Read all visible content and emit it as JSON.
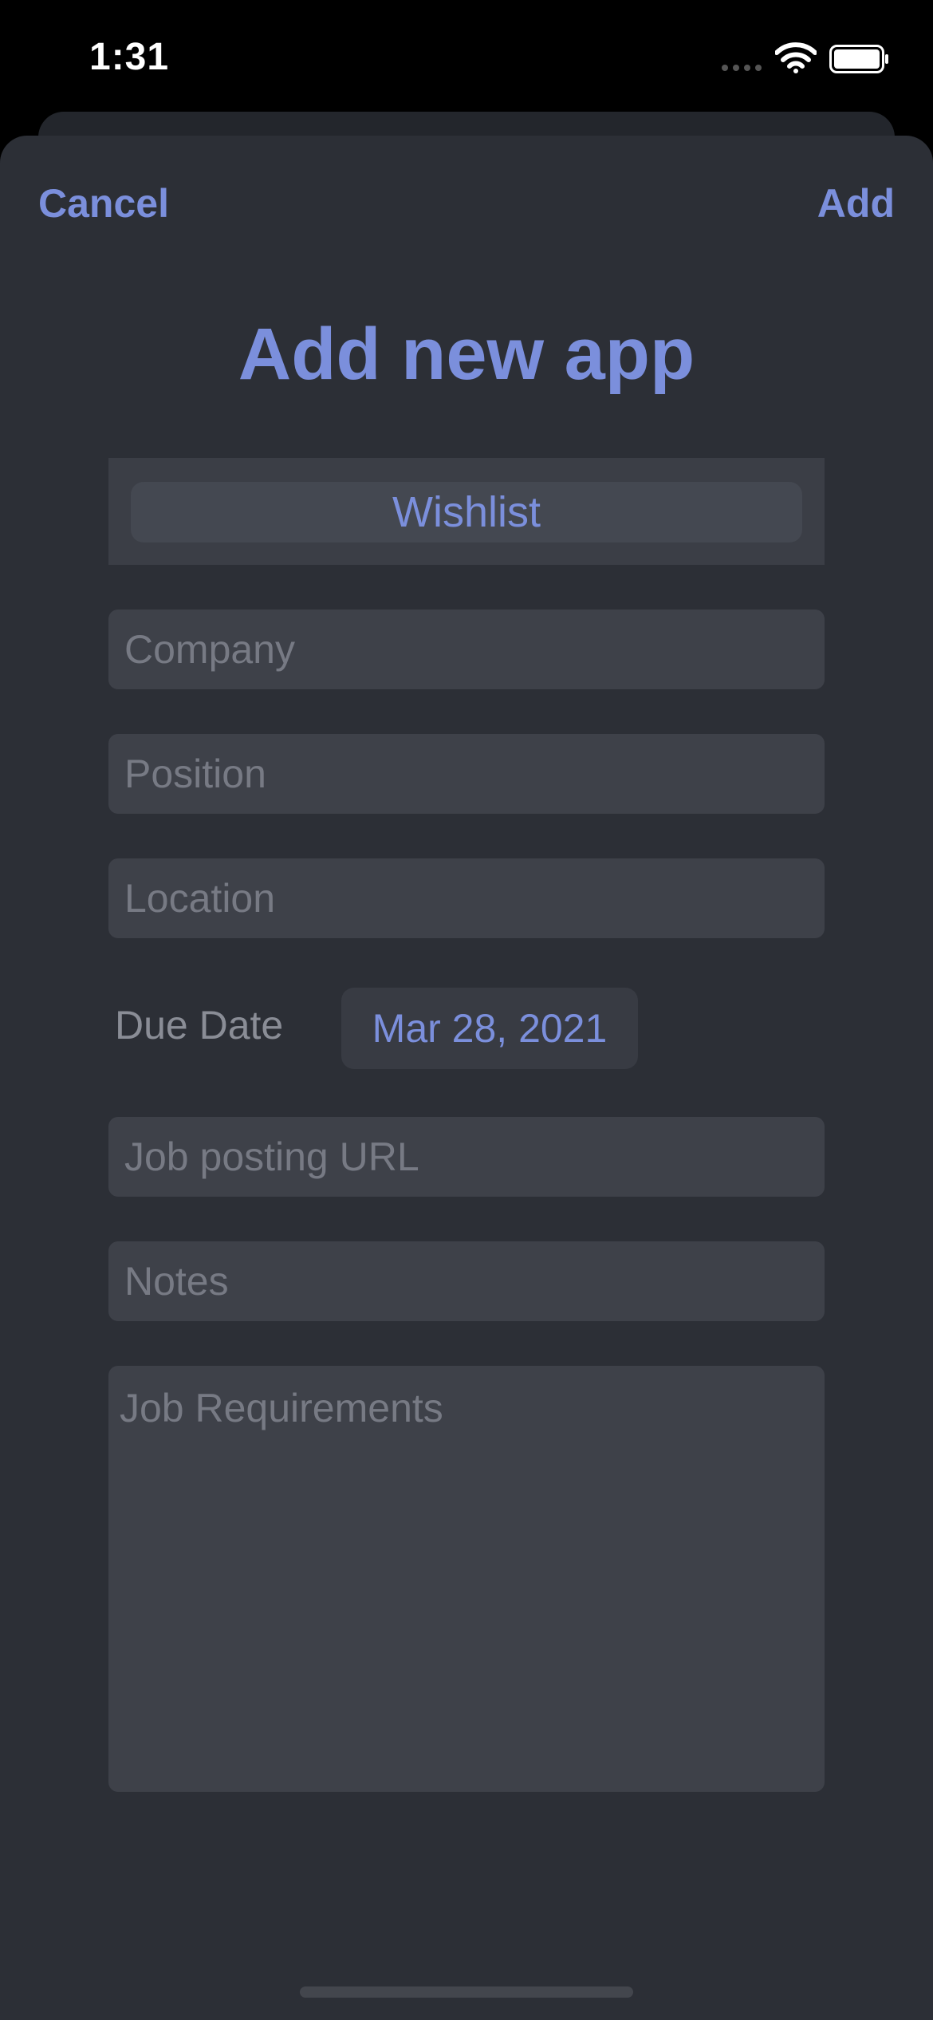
{
  "status": {
    "time": "1:31"
  },
  "nav": {
    "cancel_label": "Cancel",
    "add_label": "Add"
  },
  "title": "Add new app",
  "segment": {
    "selected": "Wishlist"
  },
  "fields": {
    "company_placeholder": "Company",
    "position_placeholder": "Position",
    "location_placeholder": "Location",
    "url_placeholder": "Job posting URL",
    "notes_placeholder": "Notes",
    "requirements_placeholder": "Job Requirements"
  },
  "due_date": {
    "label": "Due Date",
    "value": "Mar 28, 2021"
  },
  "colors": {
    "accent": "#7b8fdc",
    "sheet_bg": "#2c2f36",
    "field_bg": "#3e4149",
    "placeholder": "#777a84"
  },
  "icons": {
    "signal": "signal-icon",
    "wifi": "wifi-icon",
    "battery": "battery-icon"
  }
}
